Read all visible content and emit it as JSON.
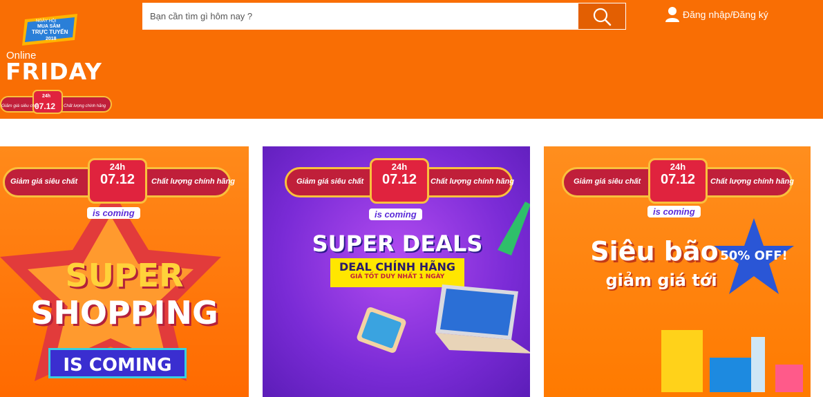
{
  "logo": {
    "badge_lines": [
      "NGÀY HỘI",
      "MUA SẮM",
      "TRỰC TUYẾN",
      "2018"
    ],
    "online": "Online",
    "friday": "FRIDAY",
    "ribbon_left": "Giảm giá siêu chất",
    "ribbon_date": "07.12",
    "ribbon_hour": "24h",
    "ribbon_right": "Chất lượng chính hãng"
  },
  "search": {
    "placeholder": "Bạn cần tìm gì hôm nay ?",
    "value": "",
    "button_icon": "search-icon"
  },
  "account": {
    "icon": "user-icon",
    "label": "Đăng nhập/Đăng ký"
  },
  "colors": {
    "header_bg": "#f96e04",
    "search_btn": "#e35f02"
  },
  "banners": [
    {
      "promo_left": "Giảm giá siêu chất",
      "promo_hour": "24h",
      "promo_date": "07.12",
      "promo_right": "Chất lượng chính hãng",
      "coming": "is coming",
      "line1": "SUPER",
      "line2": "SHOPPING",
      "line3": "IS COMING"
    },
    {
      "promo_left": "Giảm giá siêu chất",
      "promo_hour": "24h",
      "promo_date": "07.12",
      "promo_right": "Chất lượng chính hãng",
      "coming": "is coming",
      "line1": "SUPER DEALS",
      "line2": "DEAL CHÍNH HÃNG",
      "line3": "GIÁ TỐT DUY NHẤT 1 NGÀY"
    },
    {
      "promo_left": "Giảm giá siêu chất",
      "promo_hour": "24h",
      "promo_date": "07.12",
      "promo_right": "Chất lượng chính hãng",
      "coming": "is coming",
      "line1": "Siêu bão",
      "line2": "giảm giá tới",
      "line3": "50% OFF!"
    }
  ]
}
